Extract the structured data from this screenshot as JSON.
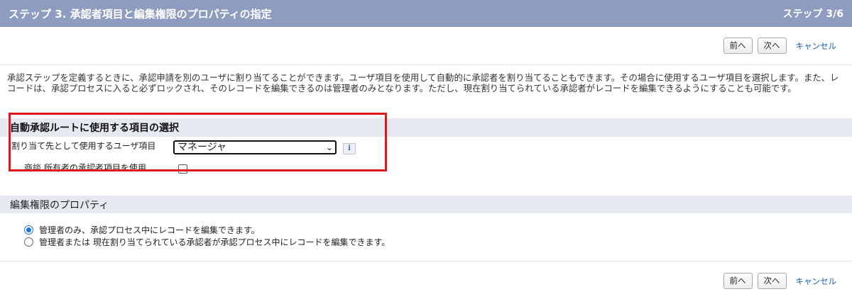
{
  "header": {
    "title": "ステップ 3. 承認者項目と編集権限のプロパティの指定",
    "step": "ステップ 3/6"
  },
  "nav": {
    "prev_label": "前へ",
    "next_label": "次へ",
    "cancel_label": "キャンセル"
  },
  "description": "承認ステップを定義するときに、承認申請を別のユーザに割り当てることができます。ユーザ項目を使用して自動的に承認者を割り当てることもできます。その場合に使用するユーザ項目を選択します。また、レコードは、承認プロセスに入ると必ずロックされ、そのレコードを編集できるのは管理者のみとなります。ただし、現在割り当てられている承認者がレコードを編集できるようにすることも可能です。",
  "auto_route": {
    "section_title": "自動承認ルートに使用する項目の選択",
    "assign_label": "割り当て先として使用するユーザ項目",
    "assign_value": "マネージャ",
    "info_icon": "info-icon",
    "owner_label": "商談 所有者の承認者項目を使用",
    "owner_checked": false
  },
  "edit_permission": {
    "section_title": "編集権限のプロパティ",
    "options": [
      {
        "label": "管理者のみ、承認プロセス中にレコードを編集できます。",
        "selected": true
      },
      {
        "label": "管理者または 現在割り当てられている承認者が承認プロセス中にレコードを編集できます。",
        "selected": false
      }
    ]
  },
  "colors": {
    "header_bg": "#8e9dbf",
    "section_bg": "#e6e9f0",
    "highlight": "#e0161b",
    "link": "#1a5ea8",
    "radio_selected": "#1a73e8"
  }
}
